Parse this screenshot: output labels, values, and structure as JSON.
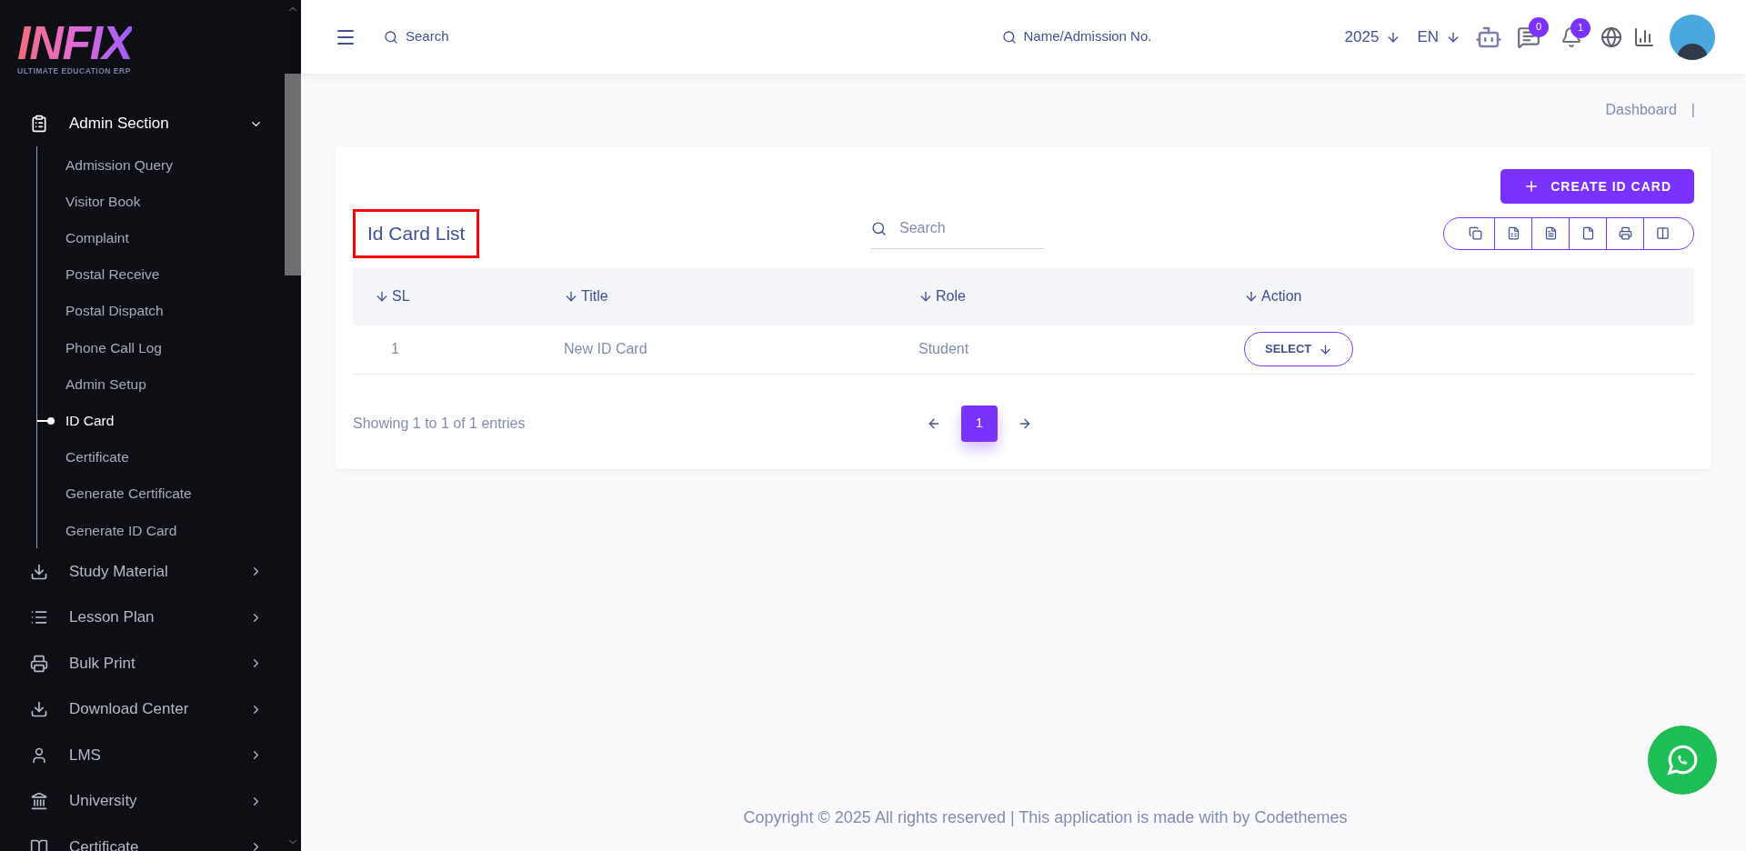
{
  "sidebar": {
    "logo": {
      "title": "INFIX",
      "subtitle": "ULTIMATE EDUCATION ERP"
    },
    "items": [
      {
        "label": "Admin Section",
        "expanded": true,
        "children": [
          {
            "label": "Admission Query",
            "selected": false
          },
          {
            "label": "Visitor Book",
            "selected": false
          },
          {
            "label": "Complaint",
            "selected": false
          },
          {
            "label": "Postal Receive",
            "selected": false
          },
          {
            "label": "Postal Dispatch",
            "selected": false
          },
          {
            "label": "Phone Call Log",
            "selected": false
          },
          {
            "label": "Admin Setup",
            "selected": false
          },
          {
            "label": "ID Card",
            "selected": true
          },
          {
            "label": "Certificate",
            "selected": false
          },
          {
            "label": "Generate Certificate",
            "selected": false
          },
          {
            "label": "Generate ID Card",
            "selected": false
          }
        ]
      },
      {
        "label": "Study Material",
        "expanded": false
      },
      {
        "label": "Lesson Plan",
        "expanded": false
      },
      {
        "label": "Bulk Print",
        "expanded": false
      },
      {
        "label": "Download Center",
        "expanded": false
      },
      {
        "label": "LMS",
        "expanded": false
      },
      {
        "label": "University",
        "expanded": false
      },
      {
        "label": "Certificate",
        "expanded": false
      }
    ]
  },
  "header": {
    "search": {
      "placeholder": "Search"
    },
    "student_search": {
      "placeholder": "Name/Admission No."
    },
    "year": "2025",
    "language": "EN",
    "messages_badge": "0",
    "notifications_badge": "1"
  },
  "breadcrumb": {
    "items": [
      "Dashboard"
    ],
    "separator": "|"
  },
  "panel": {
    "create_button": "CREATE ID CARD",
    "title": "Id Card List",
    "search": {
      "placeholder": "Search"
    },
    "table": {
      "columns": [
        "SL",
        "Title",
        "Role",
        "Action"
      ],
      "rows": [
        {
          "cells": [
            "1",
            "New ID Card",
            "Student"
          ],
          "action": "SELECT"
        }
      ]
    },
    "info": "Showing 1 to 1 of 1 entries",
    "pages": [
      {
        "label": "1",
        "selected": true
      }
    ]
  },
  "footer": "Copyright © 2025 All rights reserved | This application is made with by Codethemes"
}
